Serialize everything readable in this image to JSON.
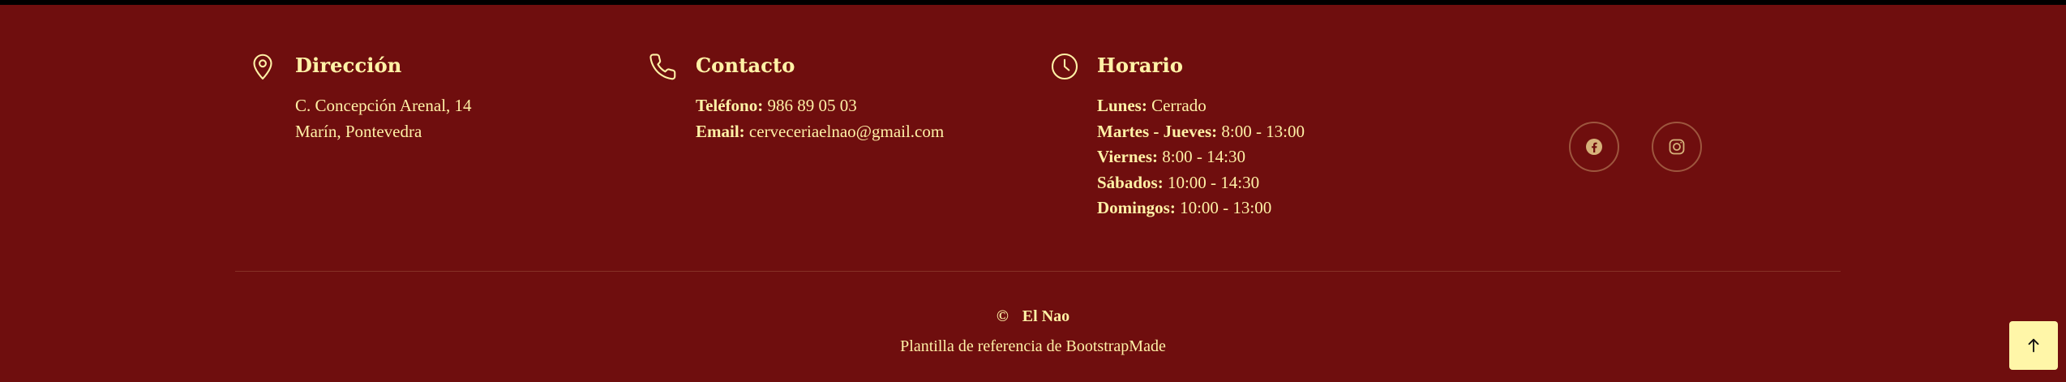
{
  "colors": {
    "background": "#6f0e0e",
    "text": "#fff1a6",
    "top_bar": "#000000",
    "back_to_top_bg": "#fff6a8"
  },
  "address": {
    "icon": "map-pin-icon",
    "title": "Dirección",
    "lines": [
      "C. Concepción Arenal, 14",
      "Marín, Pontevedra"
    ]
  },
  "contact": {
    "icon": "phone-icon",
    "title": "Contacto",
    "phone_label": "Teléfono:",
    "phone_value": "986 89 05 03",
    "email_label": "Email:",
    "email_value": "cerveceriaelnao@gmail.com"
  },
  "hours": {
    "icon": "clock-icon",
    "title": "Horario",
    "rows": [
      {
        "day": "Lunes:",
        "time": "Cerrado"
      },
      {
        "day": "Martes - Jueves:",
        "time": "8:00 - 13:00"
      },
      {
        "day": "Viernes:",
        "time": "8:00 - 14:30"
      },
      {
        "day": "Sábados:",
        "time": "10:00 - 14:30"
      },
      {
        "day": "Domingos:",
        "time": "10:00 - 13:00"
      }
    ]
  },
  "social": [
    {
      "icon": "facebook-icon"
    },
    {
      "icon": "instagram-icon"
    }
  ],
  "footer": {
    "copyright_symbol": "©",
    "brand": "El Nao",
    "credits": "Plantilla de referencia de BootstrapMade"
  },
  "back_to_top": {
    "icon": "arrow-up-icon"
  }
}
